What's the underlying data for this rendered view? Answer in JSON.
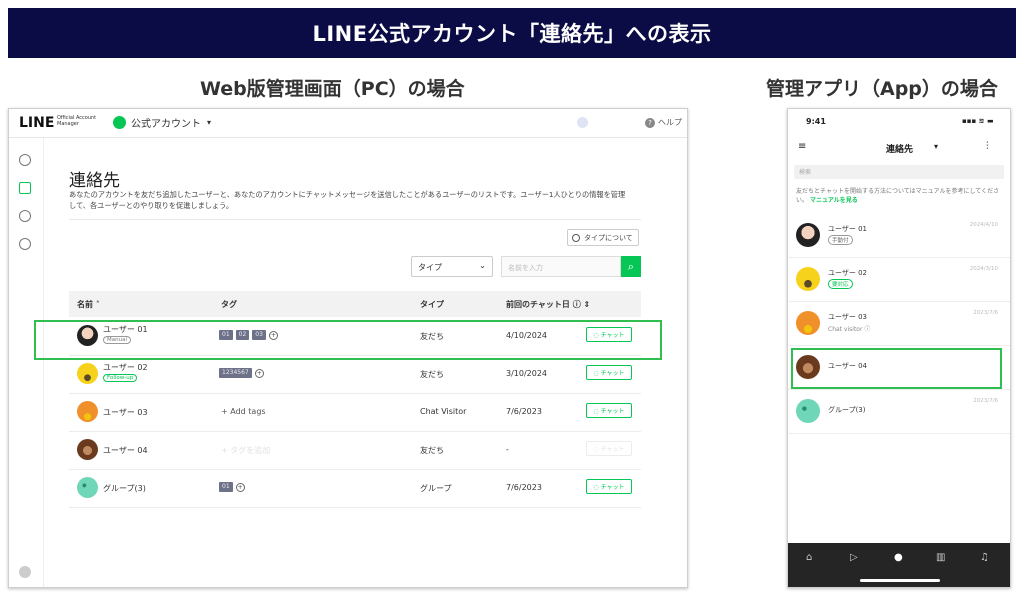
{
  "banner": "LINE公式アカウント「連絡先」への表示",
  "pc_section_title": "Web版管理画面（PC）の場合",
  "app_section_title": "管理アプリ（App）の場合",
  "pc": {
    "logo": "LINE",
    "logo_sub": "Official Account Manager",
    "account_name": "公式アカウント",
    "help": "ヘルプ",
    "page_title": "連絡先",
    "description": "あなたのアカウントを友だち追加したユーザーと、あなたのアカウントにチャットメッセージを送信したことがあるユーザーのリストです。ユーザー1人ひとりの情報を管理して、各ユーザーとのやり取りを促進しましょう。",
    "type_help": "タイプについて",
    "type_select": "タイプ",
    "search_placeholder": "名前を入力",
    "headers": {
      "name": "名前 ˄",
      "tag": "タグ",
      "type": "タイプ",
      "last_chat": "前回のチャット日 ⓘ ⇕"
    },
    "rows": [
      {
        "name": "ユーザー 01",
        "badge": "Manual",
        "tags": [
          "01",
          "02",
          "03"
        ],
        "type": "友だち",
        "date": "4/10/2024",
        "chat": "◌ チャット"
      },
      {
        "name": "ユーザー 02",
        "badge": "Follow-up",
        "tags": [
          "1234567"
        ],
        "type": "友だち",
        "date": "3/10/2024",
        "chat": "◌ チャット"
      },
      {
        "name": "ユーザー 03",
        "add_tags": "+ Add tags",
        "type": "Chat Visitor",
        "date": "7/6/2023",
        "chat": "◌ チャット"
      },
      {
        "name": "ユーザー 04",
        "add_tags": "+ タグを追加",
        "type": "友だち",
        "date": "-",
        "chat": "◌ チャット"
      },
      {
        "name": "グループ(3)",
        "tags": [
          "01"
        ],
        "type": "グループ",
        "date": "7/6/2023",
        "chat": "◌ チャット"
      }
    ]
  },
  "app": {
    "time": "9:41",
    "signal": "▪▪▪ ≋ ▬",
    "title": "連絡先",
    "search_placeholder": "検索",
    "note": "友だちとチャットを開始する方法についてはマニュアルを参考にしてください。",
    "note_link": "マニュアルを見る",
    "rows": [
      {
        "name": "ユーザー 01",
        "badge": "手動付",
        "date": "2024/4/10"
      },
      {
        "name": "ユーザー 02",
        "badge": "要対応",
        "date": "2024/3/10"
      },
      {
        "name": "ユーザー 03",
        "sub": "Chat visitor ⓘ",
        "date": "2023/7/6"
      },
      {
        "name": "ユーザー 04"
      },
      {
        "name": "グループ(3)",
        "date": "2023/7/6"
      }
    ]
  }
}
